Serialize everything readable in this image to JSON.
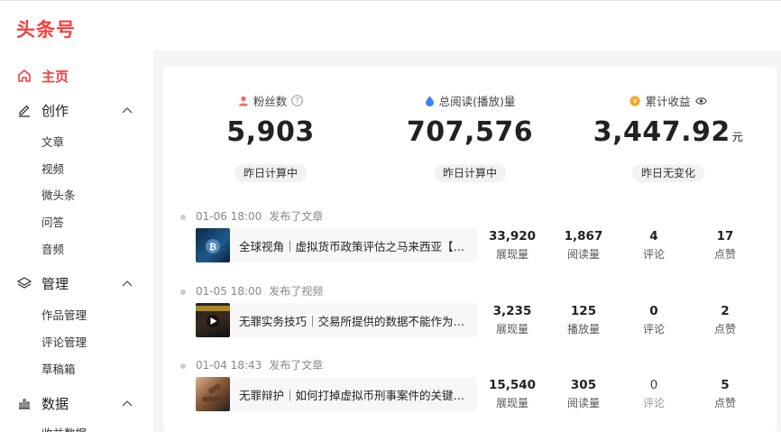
{
  "brand": {
    "logo": "头条号"
  },
  "sidebar": {
    "home": "主页",
    "create": {
      "label": "创作",
      "items": [
        "文章",
        "视频",
        "微头条",
        "问答",
        "音频"
      ]
    },
    "manage": {
      "label": "管理",
      "items": [
        "作品管理",
        "评论管理",
        "草稿箱"
      ]
    },
    "data": {
      "label": "数据",
      "items": [
        "收益数据"
      ]
    }
  },
  "stats": [
    {
      "label": "粉丝数",
      "value": "5,903",
      "unit": "",
      "note": "昨日计算中"
    },
    {
      "label": "总阅读(播放)量",
      "value": "707,576",
      "unit": "",
      "note": "昨日计算中"
    },
    {
      "label": "累计收益",
      "value": "3,447.92",
      "unit": "元",
      "note": "昨日无变化"
    }
  ],
  "posts": [
    {
      "date": "01-06 18:00",
      "action": "发布了文章",
      "title": "全球视角｜虚拟货币政策评估之马来西亚【开放…",
      "m1": "33,920",
      "m1l": "展现量",
      "m2": "1,867",
      "m2l": "阅读量",
      "m3": "4",
      "m3l": "评论",
      "m4": "17",
      "m4l": "点赞"
    },
    {
      "date": "01-05 18:00",
      "action": "发布了视频",
      "title": "无罪实务技巧｜交易所提供的数据不能作为定罪…",
      "m1": "3,235",
      "m1l": "展现量",
      "m2": "125",
      "m2l": "播放量",
      "m3": "0",
      "m3l": "评论",
      "m4": "2",
      "m4l": "点赞"
    },
    {
      "date": "01-04 18:43",
      "action": "发布了文章",
      "title": "无罪辩护｜如何打掉虚拟币刑事案件的关键证据…",
      "m1": "15,540",
      "m1l": "展现量",
      "m2": "305",
      "m2l": "阅读量",
      "m3": "0",
      "m3l": "评论",
      "m4": "5",
      "m4l": "点赞"
    }
  ],
  "colors": {
    "accent": "#f04142",
    "text": "#222222",
    "muted": "#888888"
  }
}
